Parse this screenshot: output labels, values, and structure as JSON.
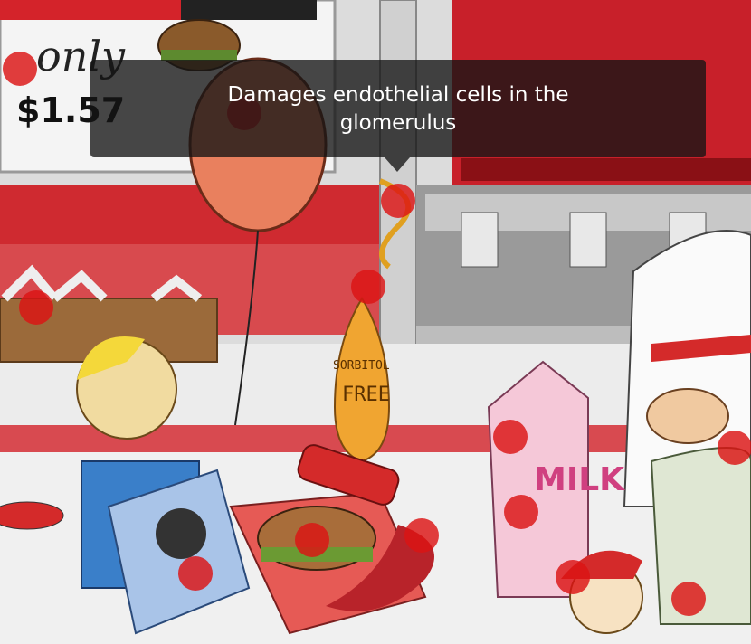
{
  "scene": {
    "sign": {
      "only_text": "only",
      "price_text": "$1.57"
    },
    "bottle_label": {
      "line1": "SORBITOL",
      "line2": "FREE"
    },
    "carton_label": "MILK"
  },
  "tooltip": {
    "text": "Damages endothelial cells in the glomerulus"
  },
  "hotspots": [
    {
      "id": "sign"
    },
    {
      "id": "balloon"
    },
    {
      "id": "balloon-string-knot"
    },
    {
      "id": "bottle-cap"
    },
    {
      "id": "plates"
    },
    {
      "id": "milk-carton-top"
    },
    {
      "id": "milk-carton-side"
    },
    {
      "id": "burger-tray"
    },
    {
      "id": "ketchup-spill"
    },
    {
      "id": "toy-box"
    },
    {
      "id": "clerk-hand"
    },
    {
      "id": "cake-jar"
    },
    {
      "id": "toddler-cap"
    }
  ]
}
